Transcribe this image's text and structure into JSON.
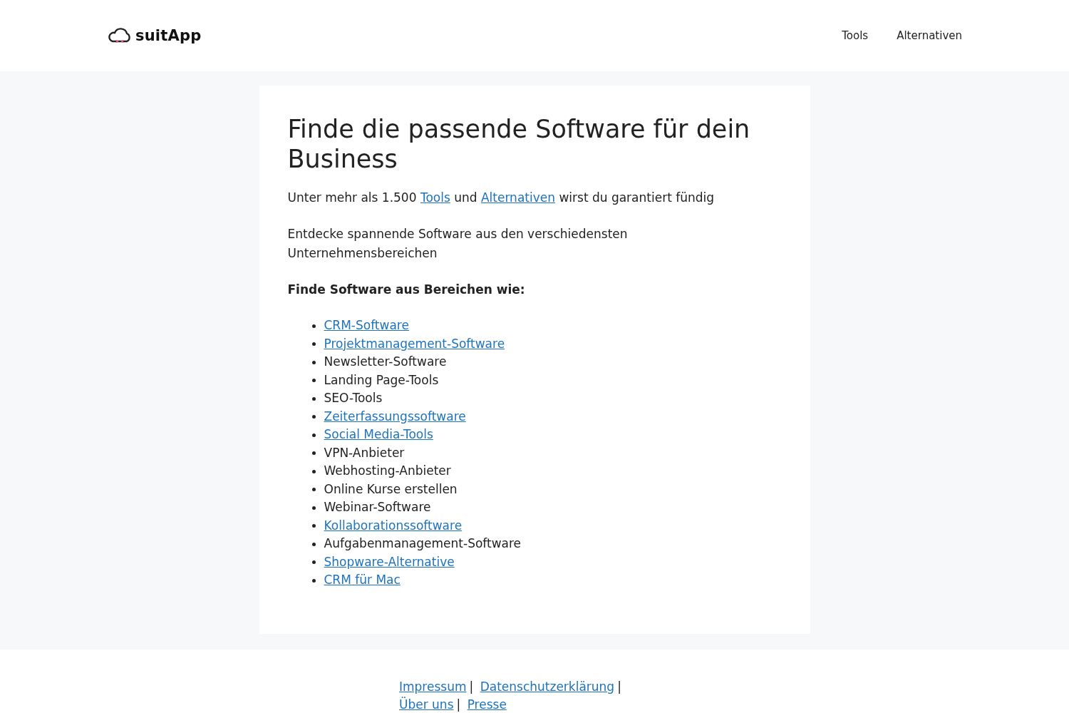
{
  "header": {
    "logo": "suitApp",
    "nav": [
      {
        "label": "Tools"
      },
      {
        "label": "Alternativen"
      }
    ]
  },
  "title": "Finde die passende Software für dein Business",
  "intro": [
    {
      "kind": "text",
      "text": "Unter mehr als 1.500 "
    },
    {
      "kind": "link",
      "text": "Tools"
    },
    {
      "kind": "text",
      "text": " und "
    },
    {
      "kind": "link",
      "text": "Alternativen"
    },
    {
      "kind": "text",
      "text": " wirst du garantiert fündig"
    }
  ],
  "paragraph": "Entdecke spannende Software aus den verschiedensten Unternehmensbereichen",
  "subheading": "Finde Software aus Bereichen wie:",
  "categories": [
    {
      "kind": "link",
      "label": "CRM-Software"
    },
    {
      "kind": "link",
      "label": "Projektmanagement-Software"
    },
    {
      "kind": "text",
      "label": "Newsletter-Software"
    },
    {
      "kind": "text",
      "label": "Landing Page-Tools"
    },
    {
      "kind": "text",
      "label": "SEO-Tools"
    },
    {
      "kind": "link",
      "label": "Zeiterfassungssoftware"
    },
    {
      "kind": "link",
      "label": "Social Media-Tools"
    },
    {
      "kind": "text",
      "label": "VPN-Anbieter"
    },
    {
      "kind": "text",
      "label": "Webhosting-Anbieter"
    },
    {
      "kind": "text",
      "label": "Online Kurse erstellen"
    },
    {
      "kind": "text",
      "label": "Webinar-Software"
    },
    {
      "kind": "link",
      "label": "Kollaborationssoftware"
    },
    {
      "kind": "text",
      "label": "Aufgabenmanagement-Software"
    },
    {
      "kind": "link",
      "label": "Shopware-Alternative"
    },
    {
      "kind": "link",
      "label": "CRM für Mac"
    }
  ],
  "footer": {
    "separator": "|",
    "links": [
      {
        "label": "Impressum"
      },
      {
        "label": "Datenschutzerklärung"
      },
      {
        "label": "Über uns"
      },
      {
        "label": "Presse"
      }
    ]
  }
}
